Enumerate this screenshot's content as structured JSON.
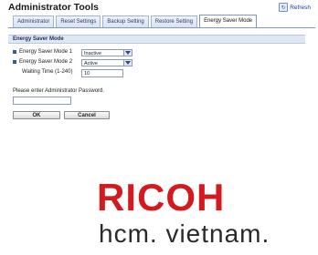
{
  "header": {
    "title": "Administrator Tools",
    "refresh_label": "Refresh"
  },
  "tabs": [
    {
      "label": "Administrator",
      "active": false
    },
    {
      "label": "Reset Settings",
      "active": false
    },
    {
      "label": "Backup Setting",
      "active": false
    },
    {
      "label": "Restore Setting",
      "active": false
    },
    {
      "label": "Energy Saver Mode",
      "active": true
    }
  ],
  "section": {
    "title": "Energy Saver Mode"
  },
  "fields": {
    "mode1_label": "Energy Saver Mode 1",
    "mode1_value": "Inactive",
    "mode2_label": "Energy Saver Mode 2",
    "mode2_value": "Active",
    "waiting_label": "Waiting Time (1-240)",
    "waiting_value": "10"
  },
  "password": {
    "prompt": "Please enter Administrator Password.",
    "value": ""
  },
  "buttons": {
    "ok": "OK",
    "cancel": "Cancel"
  },
  "watermark": {
    "brand": "RICOH",
    "subtitle": "hcm. vietnam."
  },
  "colors": {
    "brand_red": "#d21a1f",
    "accent_blue": "#3b5a9a"
  }
}
